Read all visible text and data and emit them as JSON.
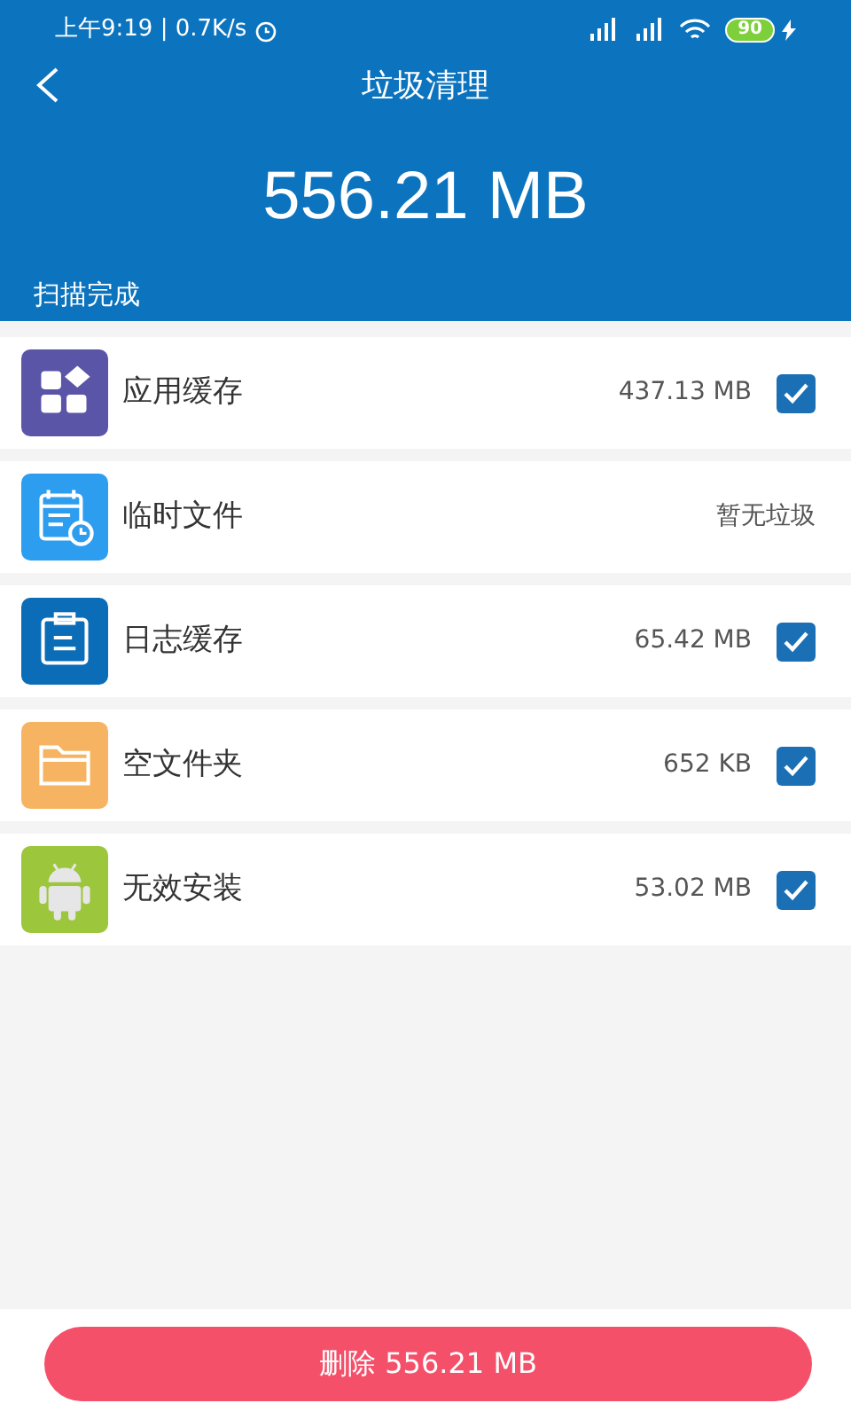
{
  "status_bar": {
    "time": "上午9:19 | 0.7K/s",
    "battery": "90"
  },
  "header": {
    "title": "垃圾清理",
    "total": "556.21 MB",
    "status": "扫描完成"
  },
  "items": [
    {
      "kind": "apps",
      "color": "#5b55a8",
      "label": "应用缓存",
      "size": "437.13 MB",
      "checked": true
    },
    {
      "kind": "calendar",
      "color": "#2d9df0",
      "label": "临时文件",
      "size": "暂无垃圾"
    },
    {
      "kind": "clipboard",
      "color": "#0b6db8",
      "label": "日志缓存",
      "size": "65.42 MB",
      "checked": true
    },
    {
      "kind": "folder",
      "color": "#f6b462",
      "label": "空文件夹",
      "size": "652 KB",
      "checked": true
    },
    {
      "kind": "android",
      "color": "#9cc63b",
      "label": "无效安装",
      "size": "53.02 MB",
      "checked": true
    }
  ],
  "delete_button": "删除 556.21 MB"
}
